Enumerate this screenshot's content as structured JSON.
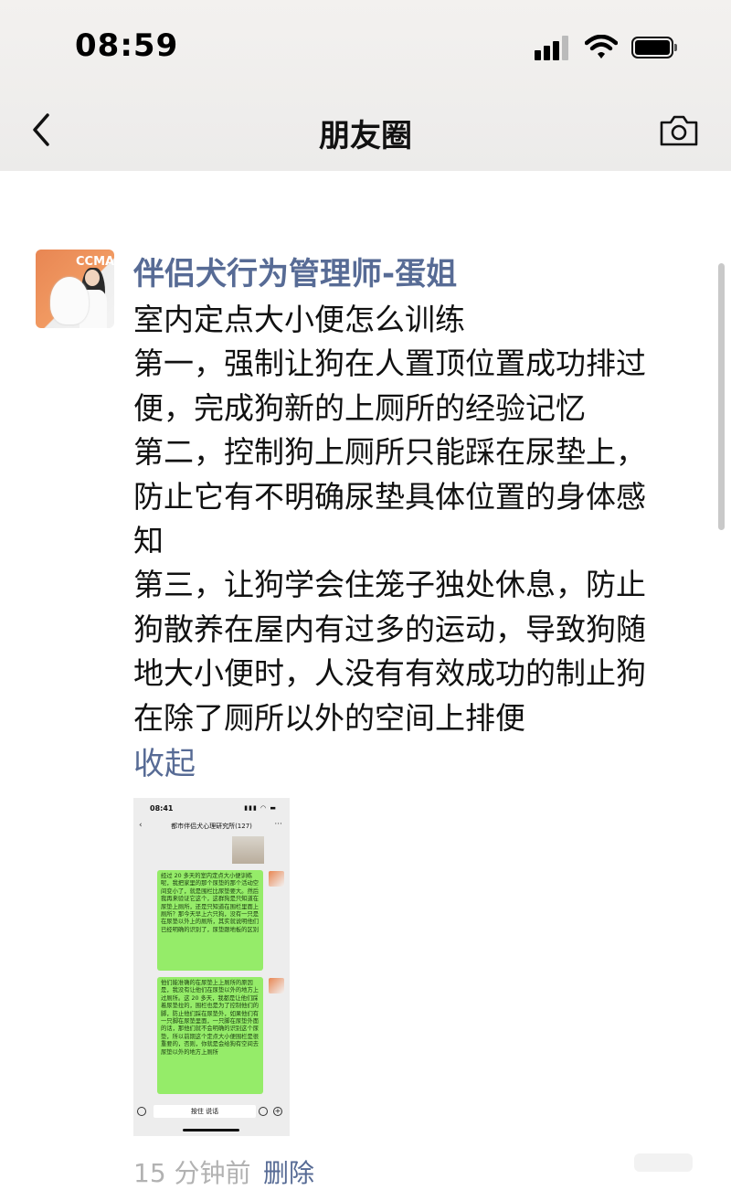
{
  "status_bar": {
    "time": "08:59"
  },
  "nav": {
    "title": "朋友圈"
  },
  "post": {
    "author": "伴侣犬行为管理师-蛋姐",
    "avatar_text": "CCMA",
    "lines": [
      "室内定点大小便怎么训练",
      "第一，强制让狗在人置顶位置成功排过",
      "便，完成狗新的上厕所的经验记忆",
      "第二，控制狗上厕所只能踩在尿垫上，",
      "防止它有不明确尿垫具体位置的身体感",
      "知",
      "第三，让狗学会住笼子独处休息，防止",
      "狗散养在屋内有过多的运动，导致狗随",
      "地大小便时，人没有有效成功的制止狗",
      "在除了厕所以外的空间上排便"
    ],
    "collapse_label": "收起",
    "footer": {
      "time": "15 分钟前",
      "delete_label": "删除"
    }
  },
  "screenshot": {
    "time": "08:41",
    "title": "都市伴侣犬心理研究所(127)",
    "bubble1": "经过 20 多天的室内定点大小便训练呢，我把家里的那个尿垫的那个活动空间变小了，就是围栏比尿垫要大。然后我再来验证它这个，这群狗是只知道在尿垫上厕所，还是只知道在围栏里面上厕所？那今天早上六只狗，没有一只是在尿垫以外上的厕所，其实就说明他们已经明确的识别了，尿垫跟地板的区别",
    "bubble2": "他们能准确的在尿垫上上厕所的原因是，我没有让他们在尿垫以外的地方上过厕所。这 20 多天，我都是让他们踩着尿垫拉的，围栏也是为了控制他们的脚，防止他们踩在尿垫外，如果他们有一只脚在尿垫里面，一只脚在尿垫外面的话，那他们就不会明确的识别这个尿垫，所以前期这个定点大小便围栏是很重要的，否则，你就是会给狗有空间去尿垫以外的地方上厕所",
    "input_label": "按住 说话"
  },
  "colors": {
    "link_blue": "#576b95",
    "bubble_green": "#95ec69"
  },
  "icons": [
    "back-chevron-icon",
    "camera-icon",
    "signal-icon",
    "wifi-icon",
    "battery-icon"
  ]
}
